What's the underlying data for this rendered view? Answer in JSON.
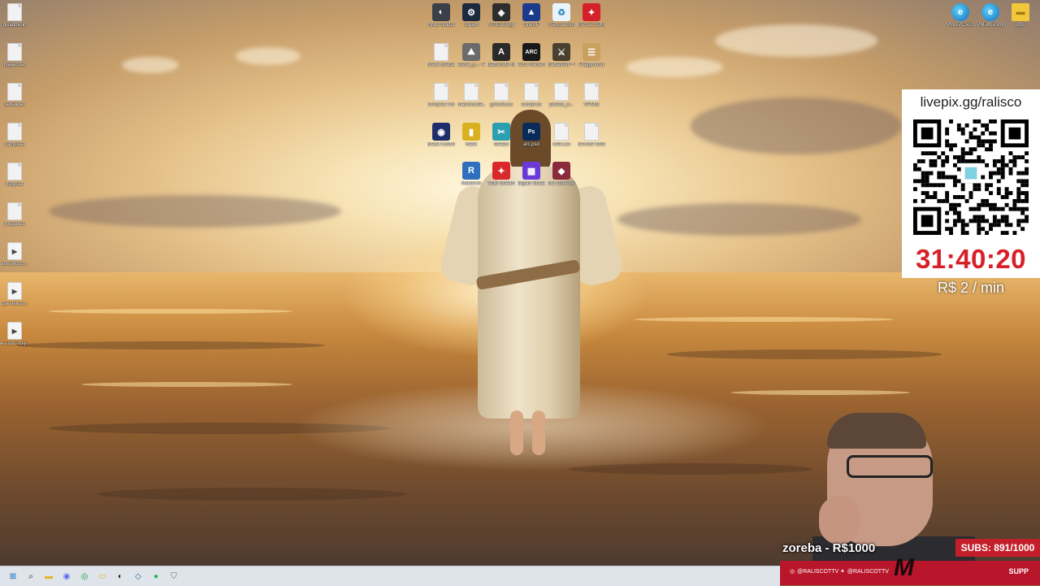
{
  "desktop": {
    "left_column": [
      {
        "label": "pixadminin",
        "type": "file"
      },
      {
        "label": "playerstat",
        "type": "file"
      },
      {
        "label": "serieleter",
        "type": "file"
      },
      {
        "label": "campstat",
        "type": "file"
      },
      {
        "label": "listgroat",
        "type": "file"
      },
      {
        "label": "livepaxes",
        "type": "file"
      },
      {
        "label": "arte-nesco...",
        "type": "video"
      },
      {
        "label": "que-deli-da...",
        "type": "video"
      },
      {
        "label": "eu-sou-no-ji...",
        "type": "video"
      }
    ],
    "grid": [
      {
        "label": "HMC Studio",
        "icon": "hmc-studio-icon",
        "color": "#3a3f4a",
        "glyph": "◐"
      },
      {
        "label": "Steam",
        "icon": "steam-icon",
        "color": "#1b2a3f",
        "glyph": "⚙"
      },
      {
        "label": "NVIDIA App",
        "icon": "nvidia-icon",
        "color": "#2d2d2d",
        "glyph": "◈"
      },
      {
        "label": "OneUP",
        "icon": "oneup-icon",
        "color": "#1c3a8c",
        "glyph": "▲"
      },
      {
        "label": "Recycle Bin",
        "icon": "recycle-bin-icon",
        "color": "#e8f4fb",
        "glyph": "♻"
      },
      {
        "label": "GPU-Z 3DMarkvdo",
        "icon": "gpuz-icon",
        "color": "#d3202a",
        "glyph": "✦"
      },
      {
        "label": "Steve Brada...",
        "icon": "file-icon",
        "color": "#f2f2f2",
        "glyph": ""
      },
      {
        "label": "arena_p...- Atalho",
        "icon": "arena-icon",
        "color": "#6b6b6b",
        "glyph": "⛰"
      },
      {
        "label": "Battlenote Stance I...",
        "icon": "battle-icon",
        "color": "#2a2a2a",
        "glyph": "A"
      },
      {
        "label": "ARC Raiders",
        "icon": "arc-raiders-icon",
        "color": "#1a1a1a",
        "glyph": "ARC"
      },
      {
        "label": "Battlefield™ 6",
        "icon": "battlefield-icon",
        "color": "#4a4030",
        "glyph": "⚔"
      },
      {
        "label": "Playground",
        "icon": "playground-icon",
        "color": "#c9a060",
        "glyph": "☰"
      },
      {
        "label": "compras VS.txt",
        "icon": "file-icon",
        "color": "#f2f2f2",
        "glyph": ""
      },
      {
        "label": "macrocodia...",
        "icon": "file-icon",
        "color": "#f2f2f2",
        "glyph": ""
      },
      {
        "label": "grocolo.txt",
        "icon": "file-icon",
        "color": "#f2f2f2",
        "glyph": ""
      },
      {
        "label": "compt.txt",
        "icon": "file-icon",
        "color": "#f2f2f2",
        "glyph": ""
      },
      {
        "label": "polsdo_d...",
        "icon": "file-icon",
        "color": "#f2f2f2",
        "glyph": ""
      },
      {
        "label": "VPNtxt",
        "icon": "file-icon",
        "color": "#f2f2f2",
        "glyph": ""
      },
      {
        "label": "Brawl Control",
        "icon": "brawl-icon",
        "color": "#1e2e6a",
        "glyph": "◉"
      },
      {
        "label": "Rask",
        "icon": "rask-icon",
        "color": "#d8b020",
        "glyph": "▮"
      },
      {
        "label": "Meads",
        "icon": "meads-icon",
        "color": "#2a9fb0",
        "glyph": "✂"
      },
      {
        "label": "arc.psd",
        "icon": "photoshop-icon",
        "color": "#0a2a5a",
        "glyph": "Ps"
      },
      {
        "label": "merc.txt",
        "icon": "file-icon",
        "color": "#f2f2f2",
        "glyph": ""
      },
      {
        "label": "Service Writer",
        "icon": "file-icon",
        "color": "#f2f2f2",
        "glyph": ""
      },
      {
        "label": "Raiders3",
        "icon": "raiders-icon",
        "color": "#2f6fc0",
        "glyph": "R"
      },
      {
        "label": "AMD Stream Master",
        "icon": "amd-icon",
        "color": "#d8282a",
        "glyph": "✦"
      },
      {
        "label": "Elgato Stream Deck",
        "icon": "stream-deck-icon",
        "color": "#6a3ad8",
        "glyph": "▦"
      },
      {
        "label": "MC Core Bessol",
        "icon": "mc-core-icon",
        "color": "#8a2a3a",
        "glyph": "◆"
      }
    ],
    "top_right": [
      {
        "label": "VM-1PC5E...",
        "icon": "edge-icon"
      },
      {
        "label": "VM-BKP.xml",
        "icon": "edge-icon"
      },
      {
        "label": "obs",
        "icon": "folder-icon"
      }
    ]
  },
  "livepix": {
    "url": "livepix.gg/ralisco",
    "timer": "31:40:20",
    "rate": "R$ 2 / min"
  },
  "overlay": {
    "donation": "zoreba - R$1000",
    "subs": "SUBS: 891/1000",
    "instagram": "@RALISCOTTV",
    "twitter": "@RALISCOTTV",
    "logo": "M",
    "supp": "SUPP"
  },
  "taskbar": {
    "items": [
      {
        "icon": "windows-start-icon",
        "glyph": "⊞",
        "color": "#0067c0"
      },
      {
        "icon": "search-icon",
        "glyph": "⌕",
        "color": "#222"
      },
      {
        "icon": "file-explorer-icon",
        "glyph": "▬",
        "color": "#e3b32a"
      },
      {
        "icon": "discord-icon",
        "glyph": "◉",
        "color": "#5865f2"
      },
      {
        "icon": "chrome-icon",
        "glyph": "◎",
        "color": "#1a9f4a"
      },
      {
        "icon": "folder-icon",
        "glyph": "▭",
        "color": "#e3b32a"
      },
      {
        "icon": "obs-icon",
        "glyph": "◐",
        "color": "#222"
      },
      {
        "icon": "vscode-icon",
        "glyph": "◇",
        "color": "#0a5fa8"
      },
      {
        "icon": "spotify-icon",
        "glyph": "●",
        "color": "#1db954"
      },
      {
        "icon": "shield-icon",
        "glyph": "⛉",
        "color": "#4a7a4a"
      }
    ]
  }
}
